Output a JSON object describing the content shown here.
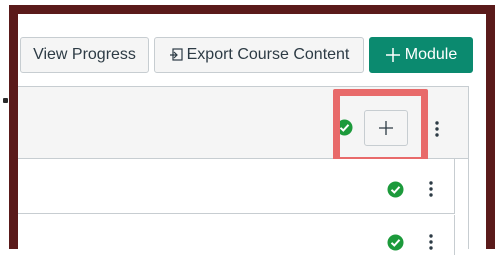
{
  "toolbar": {
    "view_progress_label": "View Progress",
    "export_label": "Export Course Content",
    "add_module_label": "Module",
    "add_module_icon": "plus-icon",
    "export_icon": "export-icon"
  },
  "module_header": {
    "status_icon": "check-circle-icon",
    "add_item_icon": "plus-icon",
    "menu_icon": "kebab-icon"
  },
  "items": [
    {
      "status_icon": "check-circle-icon",
      "menu_icon": "kebab-icon"
    },
    {
      "status_icon": "check-circle-icon",
      "menu_icon": "kebab-icon"
    }
  ],
  "colors": {
    "frame": "#5a1a1a",
    "primary": "#0b8a6f",
    "success": "#1c9a3b",
    "highlight": "#e86a6a"
  }
}
